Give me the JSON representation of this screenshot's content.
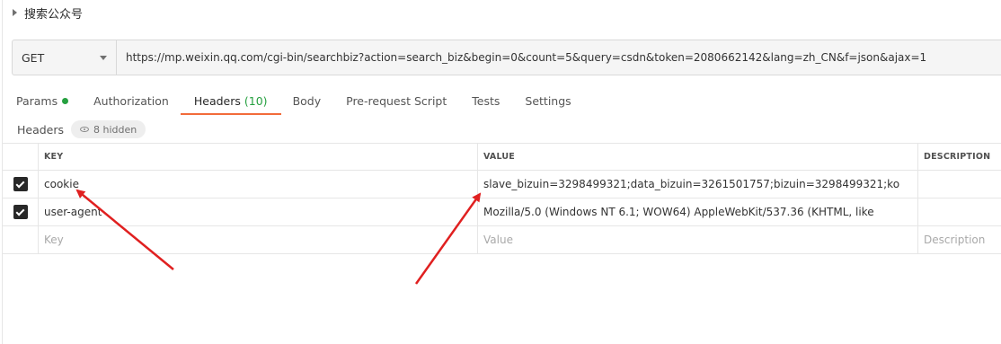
{
  "request": {
    "title": "搜索公众号"
  },
  "url_bar": {
    "method": "GET",
    "url": "https://mp.weixin.qq.com/cgi-bin/searchbiz?action=search_biz&begin=0&count=5&query=csdn&token=2080662142&lang=zh_CN&f=json&ajax=1"
  },
  "tabs": [
    {
      "label": "Params",
      "dot": true
    },
    {
      "label": "Authorization"
    },
    {
      "label": "Headers",
      "count": "(10)",
      "active": true
    },
    {
      "label": "Body"
    },
    {
      "label": "Pre-request Script"
    },
    {
      "label": "Tests"
    },
    {
      "label": "Settings"
    }
  ],
  "headers_section": {
    "label": "Headers",
    "hidden": "8 hidden"
  },
  "table": {
    "columns": {
      "key": "KEY",
      "value": "VALUE",
      "description": "DESCRIPTION"
    },
    "rows": [
      {
        "key": "cookie",
        "value": "slave_bizuin=3298499321;data_bizuin=3261501757;bizuin=3298499321;ko",
        "checked": true
      },
      {
        "key": "user-agent",
        "value": "Mozilla/5.0 (Windows NT 6.1; WOW64) AppleWebKit/537.36 (KHTML, like",
        "checked": true
      }
    ],
    "placeholders": {
      "key": "Key",
      "value": "Value",
      "description": "Description"
    }
  },
  "colors": {
    "accent": "#f26b3a",
    "green": "#26a040",
    "arrow": "#e02020"
  }
}
